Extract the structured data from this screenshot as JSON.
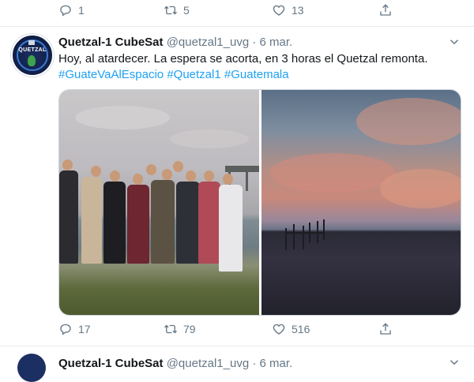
{
  "previous_tweet": {
    "actions": [
      {
        "icon": "reply-icon",
        "count": "1"
      },
      {
        "icon": "retweet-icon",
        "count": "5"
      },
      {
        "icon": "like-icon",
        "count": "13"
      },
      {
        "icon": "share-icon",
        "count": ""
      }
    ]
  },
  "tweet": {
    "author_name": "Quetzal-1 CubeSat",
    "handle": "@quetzal1_uvg",
    "separator": "·",
    "date": "6 mar.",
    "avatar_word": "QUETZAL",
    "text": "Hoy, al atardecer. La espera se acorta, en 3 horas el Quetzal remonta.",
    "hashtags": [
      "#GuateVaAlEspacio",
      "#Quetzal1",
      "#Guatemala"
    ],
    "actions": {
      "reply_count": "17",
      "retweet_count": "79",
      "like_count": "516",
      "share_count": ""
    }
  },
  "next_tweet": {
    "author_name": "Quetzal-1 CubeSat",
    "handle": "@quetzal1_uvg",
    "separator": "·",
    "date": "6 mar."
  },
  "colors": {
    "link": "#1da1f2",
    "secondary_text": "#657786",
    "primary_text": "#14171a",
    "divider": "#e6ecf0"
  }
}
